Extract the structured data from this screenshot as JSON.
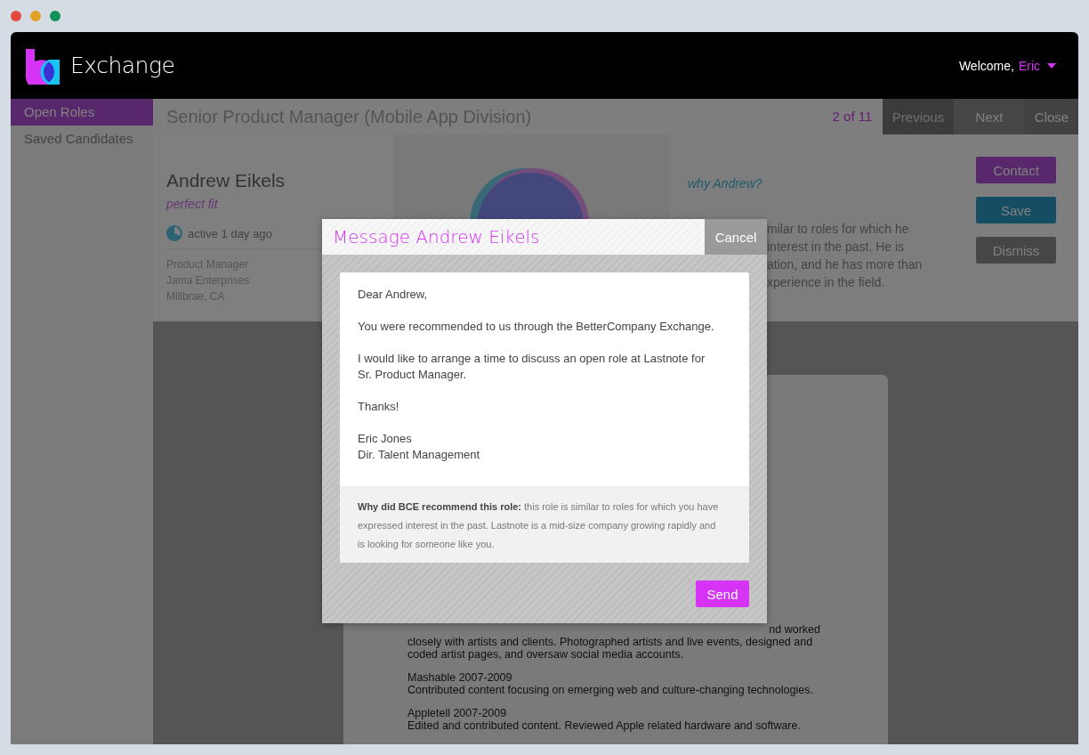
{
  "window": {
    "controls": [
      {
        "color": "#e24b3b"
      },
      {
        "color": "#e0a325"
      },
      {
        "color": "#13925a"
      }
    ]
  },
  "header": {
    "brand": "Exchange",
    "welcome": "Welcome,",
    "user": "Eric"
  },
  "sidebar": {
    "items": [
      {
        "label": "Open Roles",
        "selected": true
      },
      {
        "label": "Saved Candidates",
        "selected": false
      }
    ]
  },
  "role": {
    "title": "Senior Product Manager (Mobile App Division)",
    "position": "2 of 11",
    "nav": [
      {
        "label": "Previous",
        "disabled": true
      },
      {
        "label": "Next",
        "disabled": false
      },
      {
        "label": "Close",
        "disabled": false
      }
    ]
  },
  "candidate": {
    "name": "Andrew Eikels",
    "fit": "perfect fit",
    "activity": "active 1 day ago",
    "details": [
      "Product Manager",
      "Jama Enterprises",
      "Millbrae, CA"
    ]
  },
  "reason": {
    "heading": "why Andrew?",
    "lines": [
      "milar to roles for which he",
      "interest in the past. He is",
      "ation, and he has more than",
      "xperience in the field."
    ]
  },
  "actions": [
    {
      "label": "Contact",
      "kind": "primary"
    },
    {
      "label": "Save",
      "kind": "secondary"
    },
    {
      "label": "Dismiss",
      "kind": "neutral"
    }
  ],
  "resume": {
    "fragment": "nd worked",
    "paragraphs": [
      [
        "closely with artists and clients. Photographed artists and live events, designed and",
        "coded artist pages, and oversaw social media accounts."
      ],
      [
        "Mashable 2007-2009",
        "Contributed content focusing on emerging web and culture-changing technologies."
      ],
      [
        "Appletell 2007-2009",
        "Edited and contributed content. Reviewed Apple related hardware and software."
      ]
    ]
  },
  "modal": {
    "title": "Message Andrew Eikels",
    "cancel": "Cancel",
    "letter": [
      [
        "Dear Andrew,"
      ],
      [
        "You were recommended to us through the BetterCompany Exchange."
      ],
      [
        "I would like to arrange a time to discuss an open role at Lastnote for",
        "Sr. Product Manager."
      ],
      [
        "Thanks!"
      ],
      [
        "Eric Jones",
        "Dir. Talent Management"
      ]
    ],
    "note": "**Why did BCE recommend this role:** this role is similar to roles for which you have expressed interest in the past. Lastnote is a mid-size company growing rapidly and is looking for someone like you.",
    "send": "Send"
  }
}
